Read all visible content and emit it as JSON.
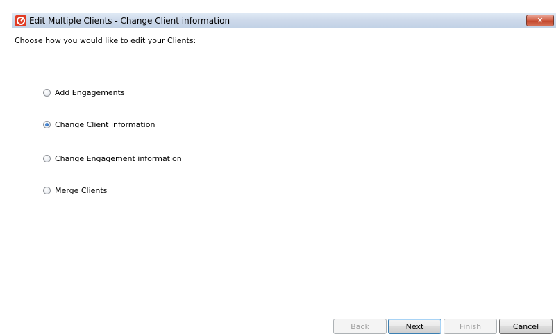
{
  "window": {
    "title": "Edit Multiple Clients - Change Client information",
    "close_label": "✕"
  },
  "prompt": "Choose how you would like to edit your Clients:",
  "options": [
    {
      "label": "Add Engagements",
      "selected": false
    },
    {
      "label": "Change Client information",
      "selected": true
    },
    {
      "label": "Change Engagement information",
      "selected": false
    },
    {
      "label": "Merge Clients",
      "selected": false
    }
  ],
  "buttons": {
    "back": {
      "label": "Back",
      "enabled": false
    },
    "next": {
      "label": "Next",
      "enabled": true
    },
    "finish": {
      "label": "Finish",
      "enabled": false
    },
    "cancel": {
      "label": "Cancel",
      "enabled": true
    }
  },
  "colors": {
    "app_icon": "#e03b24",
    "titlebar": "#cdd9ea",
    "close_button": "#c44a30"
  }
}
